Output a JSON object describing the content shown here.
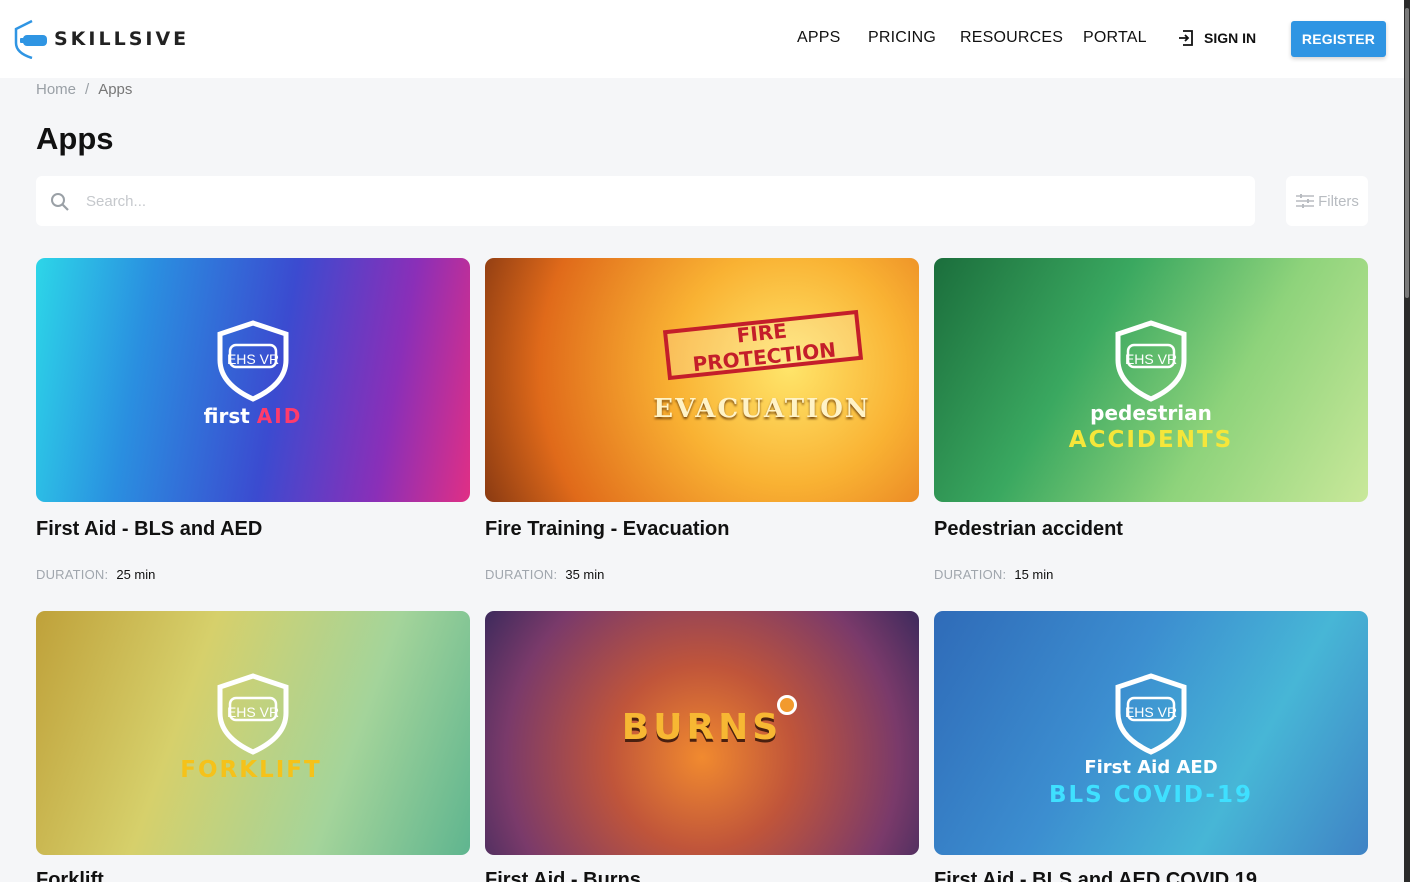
{
  "header": {
    "logo_text": "SKILLSIVE",
    "nav": [
      {
        "label": "APPS"
      },
      {
        "label": "PRICING"
      },
      {
        "label": "RESOURCES"
      },
      {
        "label": "PORTAL"
      }
    ],
    "sign_in_label": "SIGN IN",
    "register_label": "REGISTER",
    "accent_color": "#2f95e3"
  },
  "breadcrumb": {
    "home": "Home",
    "separator": "/",
    "current": "Apps"
  },
  "page_title": "Apps",
  "search": {
    "placeholder": "Search...",
    "value": ""
  },
  "filters_label": "Filters",
  "cards": [
    {
      "title": "First Aid - BLS and AED",
      "duration_label": "DURATION:",
      "duration": "25 min",
      "badge": "EHS VR",
      "art_line1": "first",
      "art_line1b": "AID",
      "art_line2": ""
    },
    {
      "title": "Fire Training - Evacuation",
      "duration_label": "DURATION:",
      "duration": "35 min",
      "badge": "",
      "art_line1": "FIRE PROTECTION",
      "art_line1b": "",
      "art_line2": "EVACUATION"
    },
    {
      "title": "Pedestrian accident",
      "duration_label": "DURATION:",
      "duration": "15 min",
      "badge": "EHS VR",
      "art_line1": "pedestrian",
      "art_line1b": "",
      "art_line2": "ACCIDENTS"
    },
    {
      "title": "Forklift",
      "badge": "EHS VR",
      "art_line1": "",
      "art_line1b": "",
      "art_line2": "FORKLIFT"
    },
    {
      "title": "First Aid - Burns",
      "badge": "",
      "art_line1": "",
      "art_line1b": "",
      "art_line2": "BURNS"
    },
    {
      "title": "First Aid - BLS and AED COVID 19",
      "badge": "EHS VR",
      "art_line1": "First Aid AED",
      "art_line1b": "",
      "art_line2": "BLS COVID-19"
    }
  ]
}
